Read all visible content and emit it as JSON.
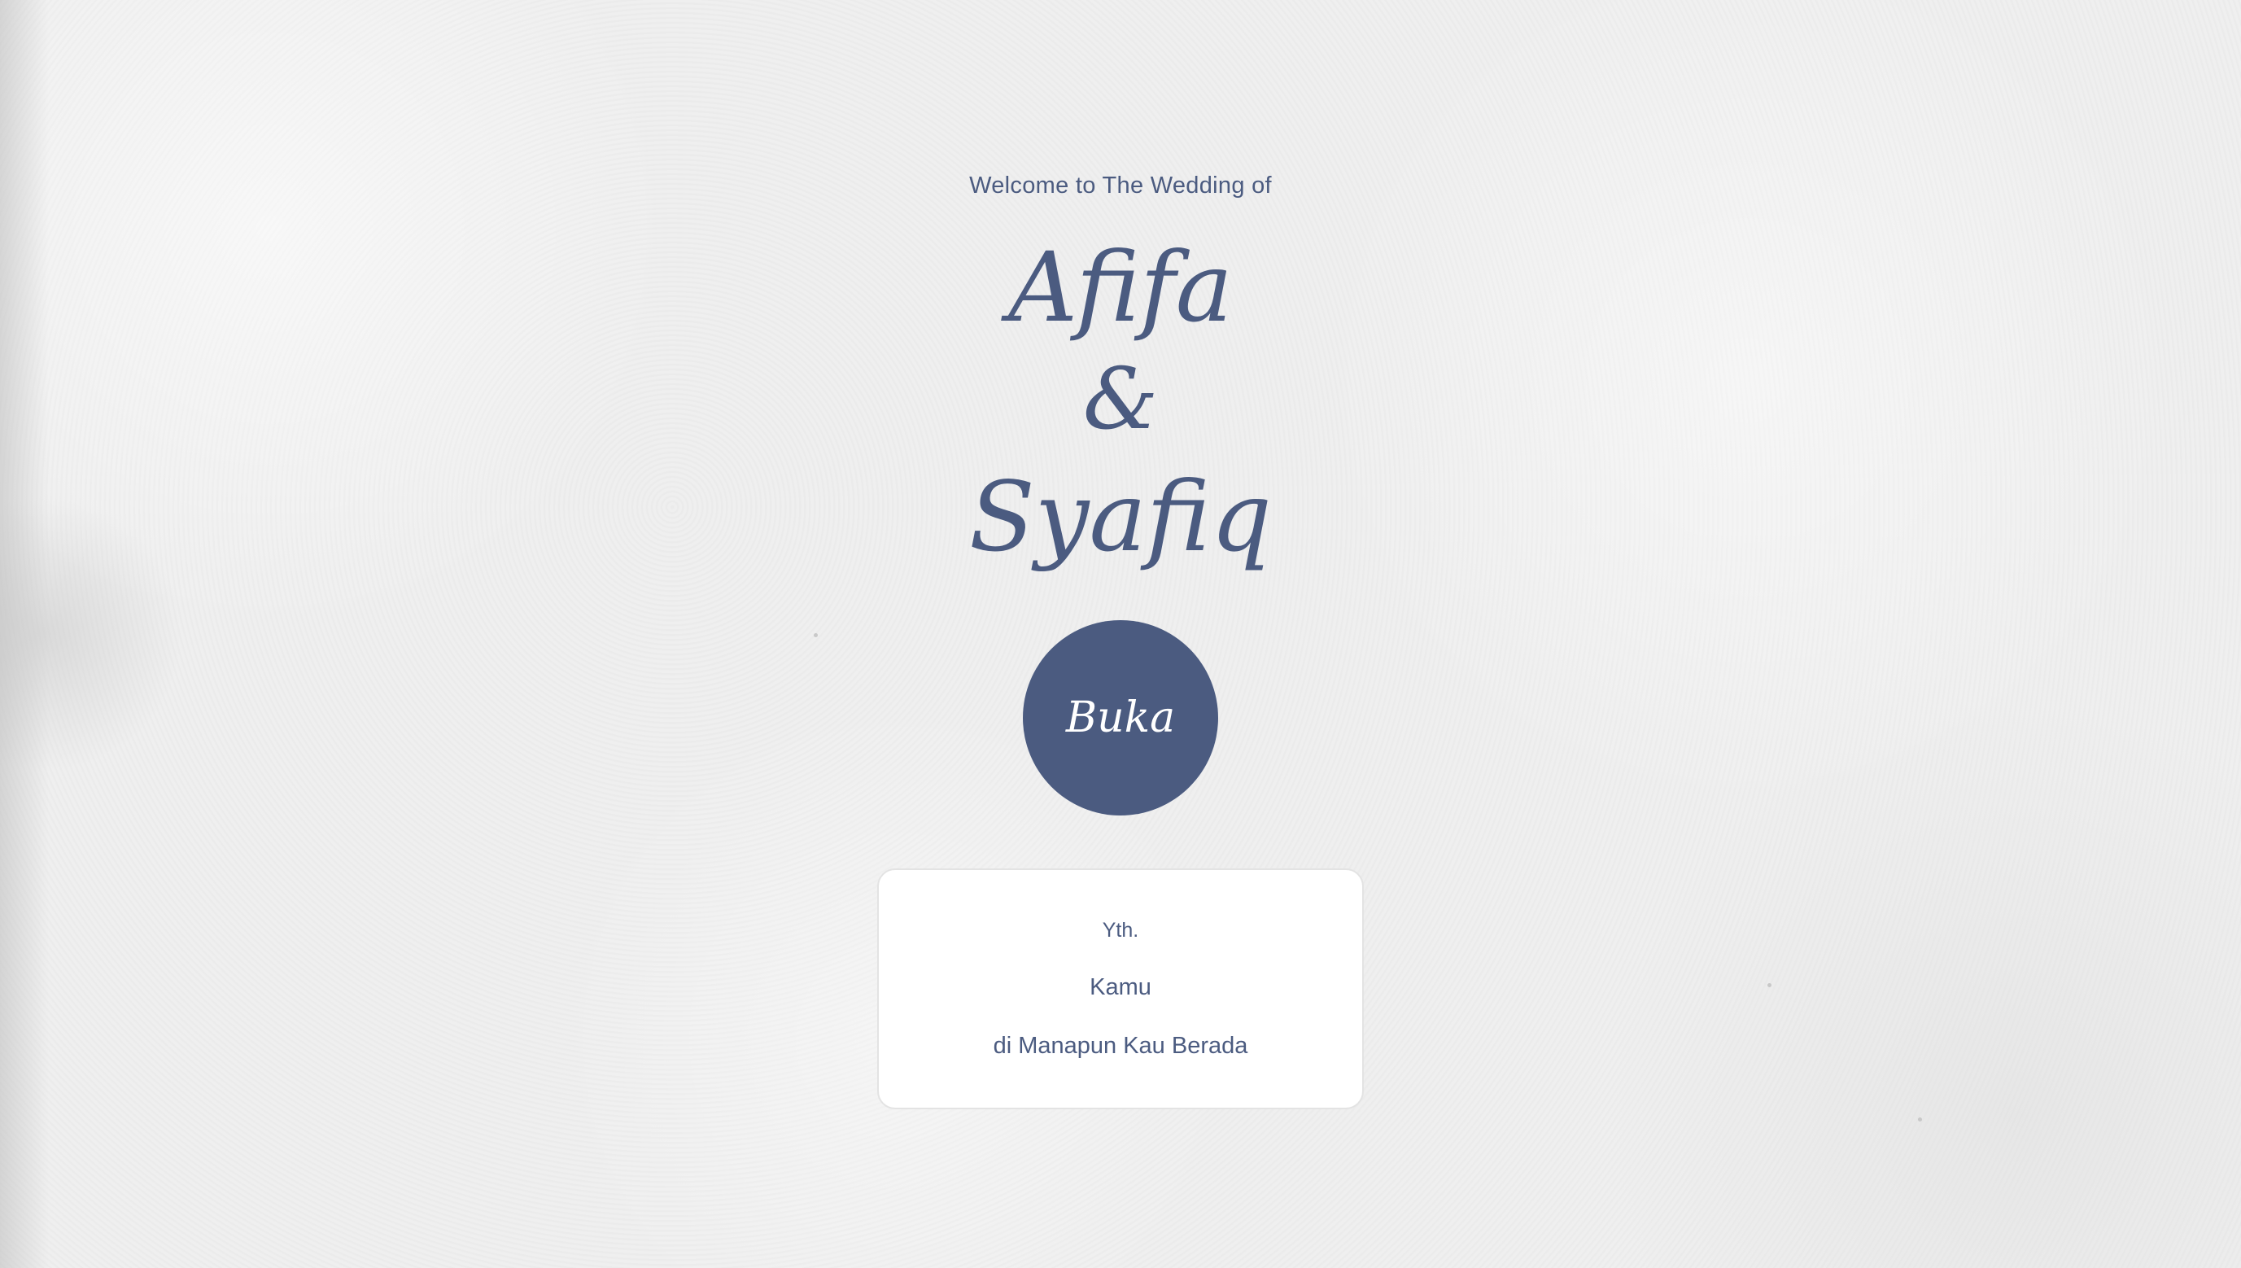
{
  "welcome_text": "Welcome to The Wedding of",
  "couple": {
    "bride": "Afifa",
    "ampersand": "&",
    "groom": "Syafiq"
  },
  "open_button_label": "Buka",
  "guest_card": {
    "salutation": "Yth.",
    "guest_name": "Kamu",
    "location": "di Manapun Kau Berada"
  },
  "colors": {
    "accent": "#4b5b80",
    "background": "#efefef",
    "card": "#ffffff"
  }
}
